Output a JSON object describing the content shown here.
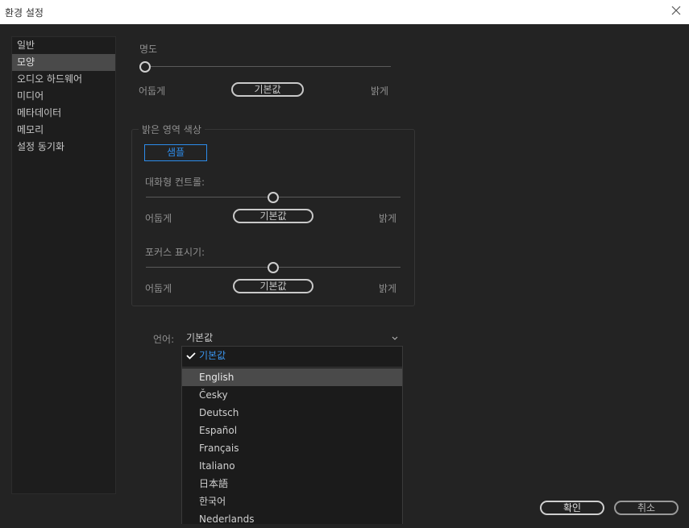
{
  "window": {
    "title": "환경 설정"
  },
  "sidebar": {
    "items": [
      {
        "label": "일반"
      },
      {
        "label": "모양"
      },
      {
        "label": "오디오 하드웨어"
      },
      {
        "label": "미디어"
      },
      {
        "label": "메타데이터"
      },
      {
        "label": "메모리"
      },
      {
        "label": "설정 동기화"
      }
    ],
    "selected_index": 1
  },
  "brightness": {
    "label": "명도",
    "level": 0,
    "dark_label": "어둡게",
    "default_label": "기본값",
    "bright_label": "밝게"
  },
  "highlight_group": {
    "title": "밝은 영역 색상",
    "sample_label": "샘플",
    "interactive_controls": {
      "label": "대화형 컨트롤:",
      "level": 0.5,
      "dark_label": "어둡게",
      "default_label": "기본값",
      "bright_label": "밝게"
    },
    "focus_indicators": {
      "label": "포커스 표시기:",
      "level": 0.5,
      "dark_label": "어둡게",
      "default_label": "기본값",
      "bright_label": "밝게"
    }
  },
  "language": {
    "label": "언어:",
    "selected": "기본값",
    "options": [
      "기본값",
      "English",
      "Česky",
      "Deutsch",
      "Español",
      "Français",
      "Italiano",
      "日本語",
      "한국어",
      "Nederlands"
    ],
    "hovered": "English"
  },
  "footer": {
    "ok_label": "확인",
    "cancel_label": "취소"
  },
  "colors": {
    "accent": "#2d8ceb",
    "background": "#232323",
    "sidebar_selected": "#4a4a4a"
  }
}
